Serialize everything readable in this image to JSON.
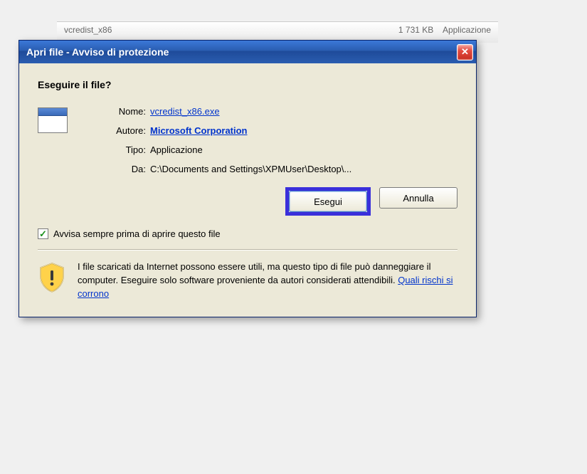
{
  "backdrop": {
    "file_hint": "vcredist_x86",
    "size_hint": "1 731 KB",
    "type_hint": "Applicazione"
  },
  "dialog": {
    "title": "Apri file - Avviso di protezione",
    "question": "Eseguire il file?",
    "labels": {
      "name": "Nome:",
      "author": "Autore:",
      "type": "Tipo:",
      "from": "Da:"
    },
    "values": {
      "name": "vcredist_x86.exe",
      "author": "Microsoft Corporation",
      "type": "Applicazione",
      "from": "C:\\Documents and Settings\\XPMUser\\Desktop\\..."
    },
    "buttons": {
      "run": "Esegui",
      "cancel": "Annulla"
    },
    "checkbox": {
      "checked": true,
      "label": "Avvisa sempre prima di aprire questo file"
    },
    "warning": {
      "text": "I file scaricati da Internet possono essere utili, ma questo tipo di file può danneggiare il computer. Eseguire solo software proveniente da autori considerati attendibili. ",
      "link": "Quali rischi si corrono"
    },
    "close_glyph": "✕",
    "check_glyph": "✓"
  }
}
